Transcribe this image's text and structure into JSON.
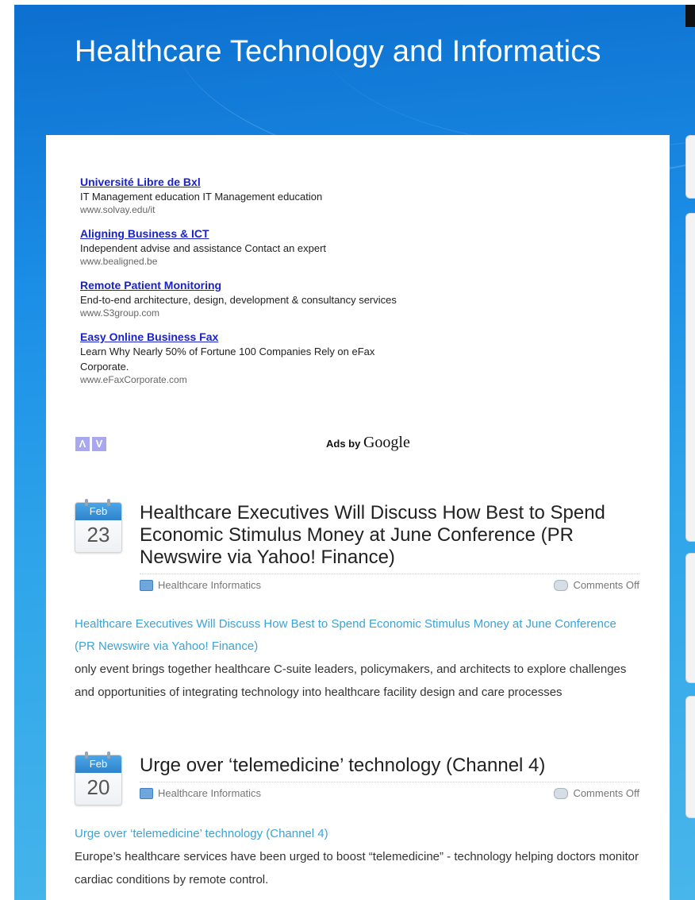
{
  "site": {
    "title": "Healthcare Technology and Informatics"
  },
  "ads": {
    "items": [
      {
        "title": "Université Libre de Bxl",
        "desc": "IT Management education IT Management education",
        "url": "www.solvay.edu/it"
      },
      {
        "title": "Aligning Business & ICT",
        "desc": "Independent advise and assistance Contact an expert",
        "url": "www.bealigned.be"
      },
      {
        "title": "Remote Patient Monitoring",
        "desc": "End-to-end architecture, design, development & consultancy services",
        "url": "www.S3group.com"
      },
      {
        "title": "Easy Online Business Fax",
        "desc": "Learn Why Nearly 50% of Fortune 100 Companies Rely on eFax Corporate.",
        "url": "www.eFaxCorporate.com"
      }
    ],
    "prev_glyph": "Λ",
    "next_glyph": "V",
    "ads_by": "Ads by",
    "google": "Google"
  },
  "posts": [
    {
      "month": "Feb",
      "day": "23",
      "title": "Healthcare Executives Will Discuss How Best to Spend Economic Stimulus Money at June Conference (PR Newswire via Yahoo! Finance)",
      "category": "Healthcare Informatics",
      "comments": "Comments Off",
      "link_text": "Healthcare Executives Will Discuss How Best to Spend Economic Stimulus Money at June Conference (PR Newswire via Yahoo! Finance)",
      "excerpt": "only event brings together healthcare C-suite leaders, policymakers, and architects to explore challenges and opportunities of integrating technology into healthcare facility design and care processes"
    },
    {
      "month": "Feb",
      "day": "20",
      "title": "Urge over ‘telemedicine’ technology (Channel 4)",
      "category": "Healthcare Informatics",
      "comments": "Comments Off",
      "link_text": "Urge over ‘telemedicine’ technology (Channel 4)",
      "excerpt": "Europe’s healthcare services have been urged to boost “telemedicine” - technology helping doctors monitor cardiac conditions by remote control."
    }
  ]
}
